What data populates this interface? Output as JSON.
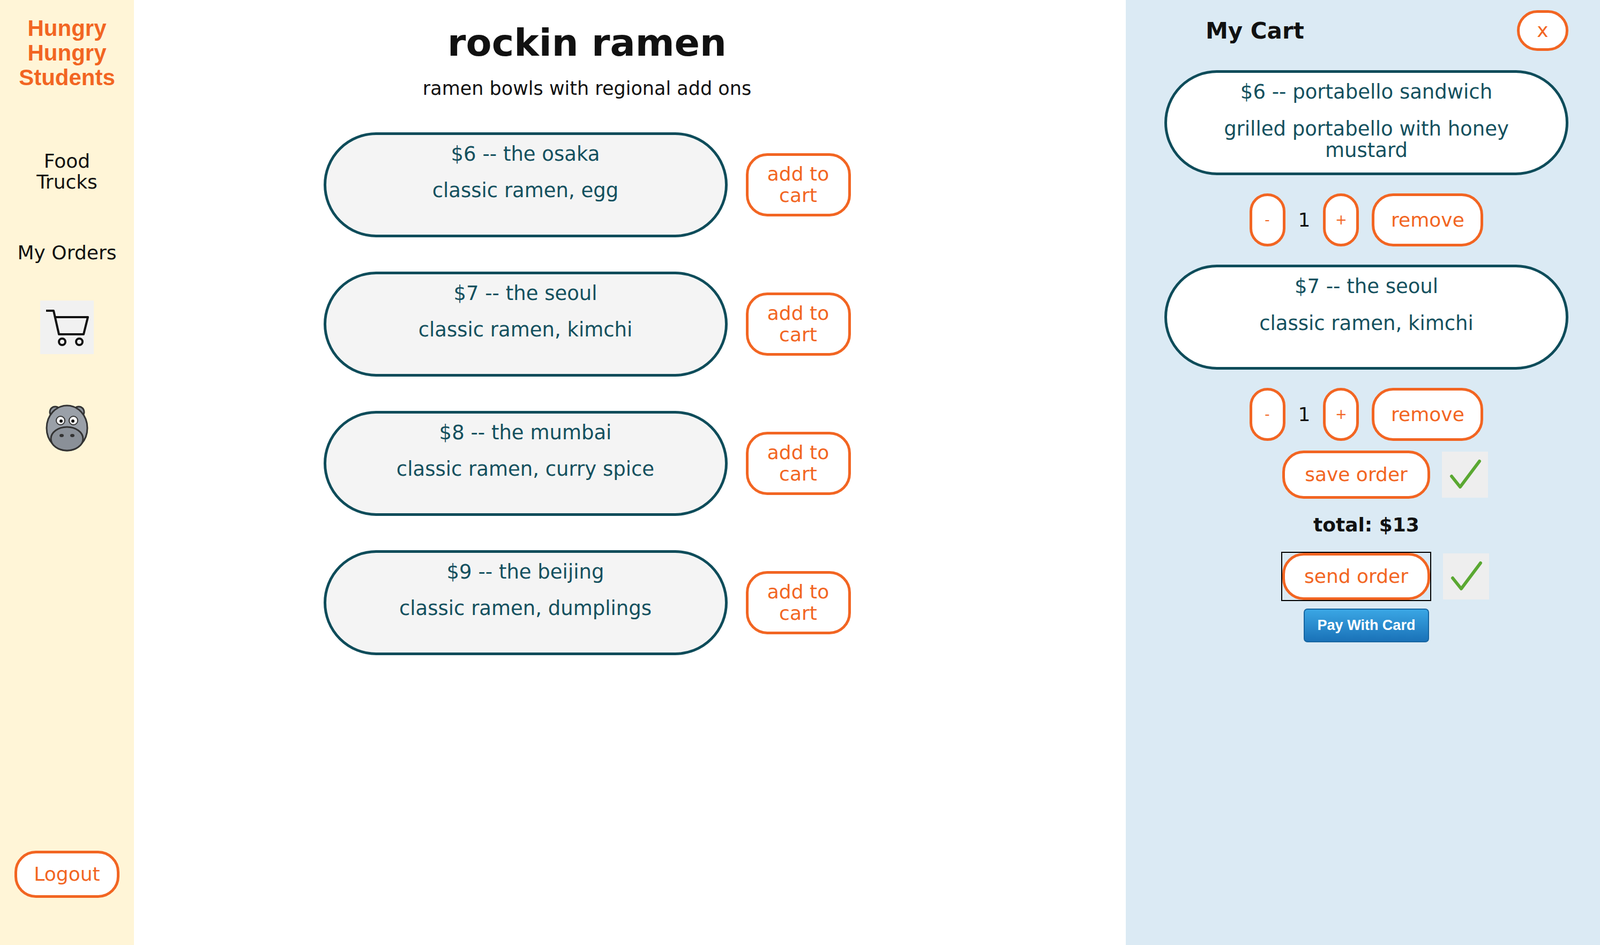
{
  "sidebar": {
    "brand": "Hungry Hungry Students",
    "items": [
      {
        "label": "Food Trucks"
      },
      {
        "label": "My Orders"
      }
    ],
    "logout": "Logout"
  },
  "truck": {
    "name": "rockin ramen",
    "description": "ramen bowls with regional add ons"
  },
  "menu": [
    {
      "title": "$6 -- the osaka",
      "details": "classic ramen, egg",
      "button": "add to cart"
    },
    {
      "title": "$7 -- the seoul",
      "details": "classic ramen, kimchi",
      "button": "add to cart"
    },
    {
      "title": "$8 -- the mumbai",
      "details": "classic ramen, curry spice",
      "button": "add to cart"
    },
    {
      "title": "$9 -- the beijing",
      "details": "classic ramen, dumplings",
      "button": "add to cart"
    }
  ],
  "cart": {
    "title": "My Cart",
    "close": "x",
    "items": [
      {
        "title": "$6 -- portabello sandwich",
        "details": "grilled portabello with honey mustard",
        "minus": "-",
        "quantity": "1",
        "plus": "+",
        "remove": "remove"
      },
      {
        "title": "$7 -- the seoul",
        "details": "classic ramen, kimchi",
        "minus": "-",
        "quantity": "1",
        "plus": "+",
        "remove": "remove"
      }
    ],
    "save": {
      "label": "save order",
      "confirmed": true
    },
    "total": "total: $13",
    "send": {
      "label": "send order",
      "confirmed": true,
      "focused": true
    },
    "pay": "Pay With Card"
  }
}
